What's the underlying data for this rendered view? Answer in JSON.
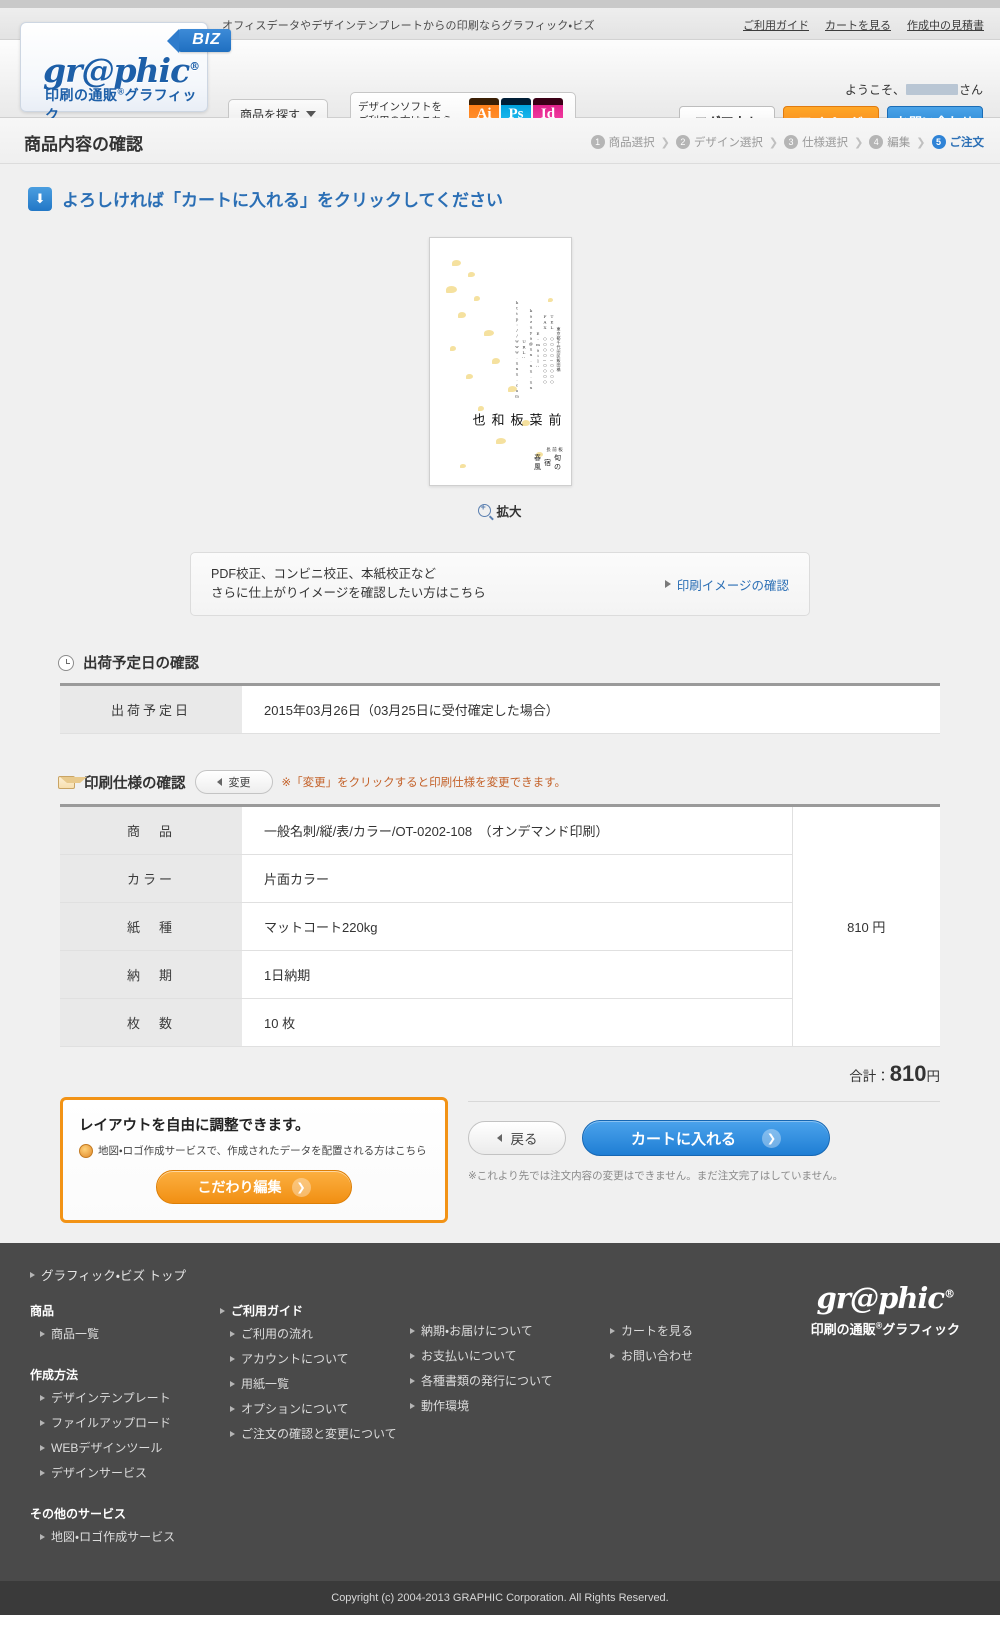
{
  "utility": {
    "tagline": "オフィスデータやデザインテンプレートからの印刷ならグラフィック・ビズ",
    "links": [
      "ご利用ガイド",
      "カートを見る",
      "作成中の見積書"
    ]
  },
  "header": {
    "biz_badge": "BIZ",
    "logo_word": "gr@phic",
    "logo_sub": "印刷の通販",
    "logo_sub2": "グラフィック",
    "search_label": "商品を探す",
    "soft_line1": "デザインソフトを",
    "soft_line2": "ご利用の方はこちら",
    "adobe": [
      "Ai",
      "Ps",
      "Id"
    ],
    "welcome_prefix": "ようこそ、",
    "welcome_suffix": "さん",
    "logout": "ログアウト",
    "mypage": "マイページ",
    "contact": "お問い合わせ"
  },
  "titlebar": {
    "title": "商品内容の確認",
    "steps": [
      {
        "num": "1",
        "label": "商品選択",
        "active": false
      },
      {
        "num": "2",
        "label": "デザイン選択",
        "active": false
      },
      {
        "num": "3",
        "label": "仕様選択",
        "active": false
      },
      {
        "num": "4",
        "label": "編集",
        "active": false
      },
      {
        "num": "5",
        "label": "ご注文",
        "active": true
      }
    ],
    "separator": "❯"
  },
  "main": {
    "notice": "よろしければ「カートに入れる」をクリックしてください",
    "card": {
      "company": "旬の宿　春風",
      "job_title": "板前長",
      "name": "前菜板 和也",
      "address": "東京都千代田区飯田橋",
      "tel": "TEL ○○○○－○○○○",
      "fax": "FAX ○○○○－○○○○",
      "email": "E-mail：kazuya@xx.xx.xx",
      "url": "URL：http://www.xxx.com"
    },
    "zoom_label": "拡大",
    "proof_line1": "PDF校正、コンビニ校正、本紙校正など",
    "proof_line2": "さらに仕上がりイメージを確認したい方はこちら",
    "proof_link": "印刷イメージの確認"
  },
  "shipping": {
    "section_title": "出荷予定日の確認",
    "label": "出荷予定日",
    "value": "2015年03月26日（03月25日に受付確定した場合）"
  },
  "spec": {
    "section_title": "印刷仕様の確認",
    "change_button": "変更",
    "change_note": "※「変更」をクリックすると印刷仕様を変更できます。",
    "rows": [
      {
        "label": "商　品",
        "value": "一般名刺/縦/表/カラー/OT-0202-108　（オンデマンド印刷）"
      },
      {
        "label": "カラー",
        "value": "片面カラー"
      },
      {
        "label": "紙　種",
        "value": "マットコート220kg"
      },
      {
        "label": "納　期",
        "value": "1日納期"
      },
      {
        "label": "枚　数",
        "value": "10 枚"
      }
    ],
    "price": "810 円",
    "total_label": "合計：",
    "total_amount": "810",
    "total_unit": "円"
  },
  "promo": {
    "title": "レイアウトを自由に調整できます。",
    "subtitle": "地図・ロゴ作成サービスで、作成されたデータを配置される方はこちら",
    "button": "こだわり編集"
  },
  "actions": {
    "back": "戻る",
    "cart": "カートに入れる",
    "note": "※これより先では注文内容の変更はできません。まだ注文完了はしていません。"
  },
  "footer": {
    "top_link": "グラフィック・ビズ トップ",
    "col1": {
      "head1": "商品",
      "links1": [
        "商品一覧"
      ],
      "head2": "作成方法",
      "links2": [
        "デザインテンプレート",
        "ファイルアップロード",
        "WEBデザインツール",
        "デザインサービス"
      ],
      "head3": "その他のサービス",
      "links3": [
        "地図・ロゴ作成サービス"
      ]
    },
    "col2": {
      "head": "ご利用ガイド",
      "links": [
        "ご利用の流れ",
        "アカウントについて",
        "用紙一覧",
        "オプションについて",
        "ご注文の確認と変更について"
      ]
    },
    "col3": {
      "links": [
        "納期・お届けについて",
        "お支払いについて",
        "各種書類の発行について",
        "動作環境"
      ]
    },
    "col4": {
      "links": [
        "カートを見る",
        "お問い合わせ"
      ]
    },
    "logo_word": "gr@phic",
    "logo_sub": "印刷の通販",
    "logo_sub2": "グラフィック",
    "copyright": "Copyright (c) 2004-2013 GRAPHIC Corporation. All Rights Reserved."
  },
  "colors": {
    "brand_blue": "#1d5fa8",
    "accent_orange": "#f29316",
    "cart_blue": "#2380cf"
  }
}
